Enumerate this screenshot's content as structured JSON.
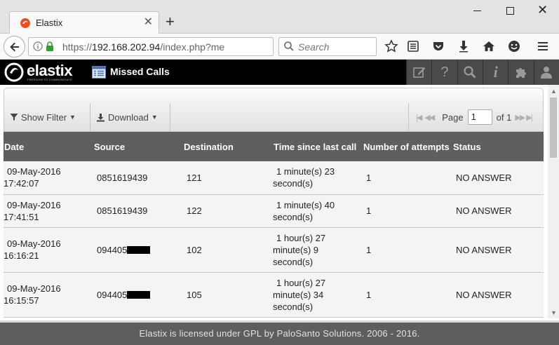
{
  "browser": {
    "tab_title": "Elastix",
    "url_scheme": "https://",
    "url_host": "192.168.202.94",
    "url_path": "/index.php?me",
    "search_placeholder": "Search"
  },
  "app": {
    "logo_text": "elastix",
    "logo_tagline": "FREEDOM TO COMMUNICATE",
    "module_title": "Missed Calls"
  },
  "toolbar": {
    "show_filter_label": "Show Filter",
    "download_label": "Download",
    "page_label": "Page",
    "page_value": "1",
    "of_label": "of 1"
  },
  "table": {
    "headers": {
      "date": "Date",
      "source": "Source",
      "destination": "Destination",
      "time_since": "Time since last call",
      "attempts": "Number of attempts",
      "status": "Status"
    },
    "rows": [
      {
        "date_1": "09-May-2016",
        "date_2": "17:42:07",
        "source": "0851619439",
        "destination": "121",
        "time_1": "1 minute(s) 23",
        "time_2": "second(s)",
        "time_3": "",
        "attempts": "1",
        "status": "NO ANSWER"
      },
      {
        "date_1": "09-May-2016",
        "date_2": "17:41:51",
        "source": "0851619439",
        "destination": "122",
        "time_1": "1 minute(s) 40",
        "time_2": "second(s)",
        "time_3": "",
        "attempts": "1",
        "status": "NO ANSWER"
      },
      {
        "date_1": "09-May-2016",
        "date_2": "16:16:21",
        "source": "094405",
        "destination": "102",
        "time_1": "1 hour(s) 27",
        "time_2": "minute(s) 9",
        "time_3": "second(s)",
        "attempts": "1",
        "status": "NO ANSWER"
      },
      {
        "date_1": "09-May-2016",
        "date_2": "16:15:57",
        "source": "094405",
        "destination": "105",
        "time_1": "1 hour(s) 27",
        "time_2": "minute(s) 34",
        "time_3": "second(s)",
        "attempts": "1",
        "status": "NO ANSWER"
      }
    ]
  },
  "footer_text": "Elastix is licensed under GPL by PaloSanto Solutions. 2006 - 2016.",
  "colors": {
    "header_bg": "#000000",
    "table_header_bg": "#5f5f5f",
    "footer_bg": "#5e5e5e"
  }
}
